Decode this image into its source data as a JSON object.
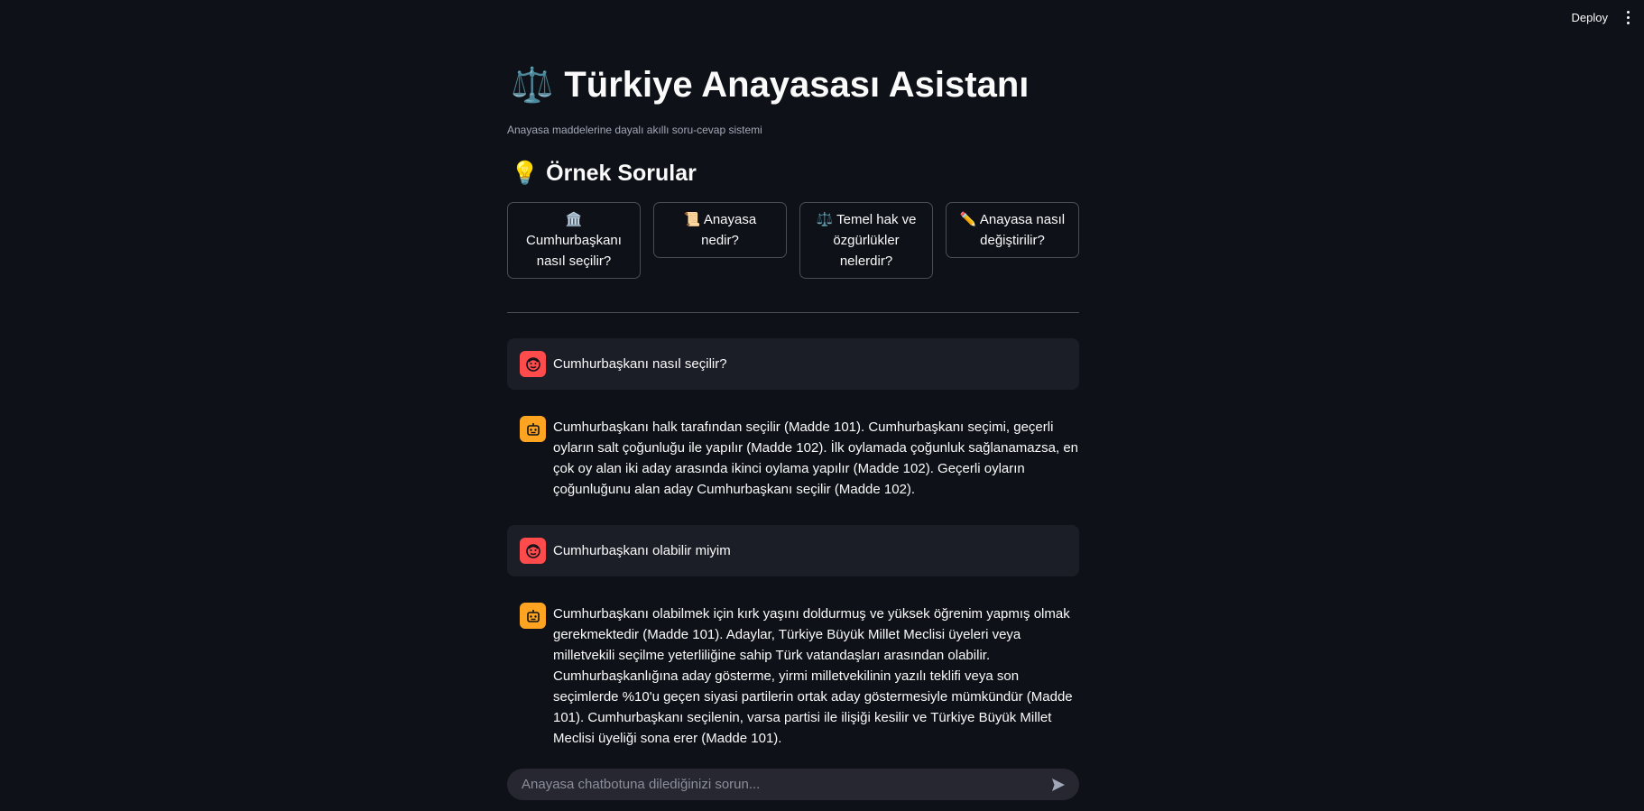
{
  "topbar": {
    "deploy_label": "Deploy",
    "menu_icon": "kebab-menu-icon"
  },
  "header": {
    "title_icon": "⚖️",
    "title": "Türkiye Anayasası Asistanı",
    "subtitle": "Anayasa maddelerine dayalı akıllı soru-cevap sistemi"
  },
  "examples": {
    "section_icon": "💡",
    "section_title": "Örnek Sorular",
    "buttons": [
      {
        "icon": "🏛️",
        "label": "Cumhurbaşkanı nasıl seçilir?"
      },
      {
        "icon": "📜",
        "label": "Anayasa nedir?"
      },
      {
        "icon": "⚖️",
        "label": "Temel hak ve özgürlükler nelerdir?"
      },
      {
        "icon": "✏️",
        "label": "Anayasa nasıl değiştirilir?"
      }
    ]
  },
  "messages": [
    {
      "role": "user",
      "avatar_icon": "user-avatar-icon",
      "text": "Cumhurbaşkanı nasıl seçilir?"
    },
    {
      "role": "assistant",
      "avatar_icon": "bot-avatar-icon",
      "text": "Cumhurbaşkanı halk tarafından seçilir (Madde 101). Cumhurbaşkanı seçimi, geçerli oyların salt çoğunluğu ile yapılır (Madde 102). İlk oylamada çoğunluk sağlanamazsa, en çok oy alan iki aday arasında ikinci oylama yapılır (Madde 102). Geçerli oyların çoğunluğunu alan aday Cumhurbaşkanı seçilir (Madde 102)."
    },
    {
      "role": "user",
      "avatar_icon": "user-avatar-icon",
      "text": "Cumhurbaşkanı olabilir miyim"
    },
    {
      "role": "assistant",
      "avatar_icon": "bot-avatar-icon",
      "text": "Cumhurbaşkanı olabilmek için kırk yaşını doldurmuş ve yüksek öğrenim yapmış olmak gerekmektedir (Madde 101). Adaylar, Türkiye Büyük Millet Meclisi üyeleri veya milletvekili seçilme yeterliliğine sahip Türk vatandaşları arasından olabilir. Cumhurbaşkanlığına aday gösterme, yirmi milletvekilinin yazılı teklifi veya son seçimlerde %10'u geçen siyasi partilerin ortak aday göstermesiyle mümkündür (Madde 101). Cumhurbaşkanı seçilenin, varsa partisi ile ilişiği kesilir ve Türkiye Büyük Millet Meclisi üyeliği sona erer (Madde 101)."
    }
  ],
  "chat_input": {
    "placeholder": "Anayasa chatbotuna dilediğinizi sorun...",
    "send_icon": "send-icon"
  },
  "colors": {
    "background": "#0e1117",
    "user_avatar": "#ff4b4b",
    "bot_avatar": "#ffa421",
    "user_bubble": "#1b1e27",
    "input_bg": "#262730"
  }
}
